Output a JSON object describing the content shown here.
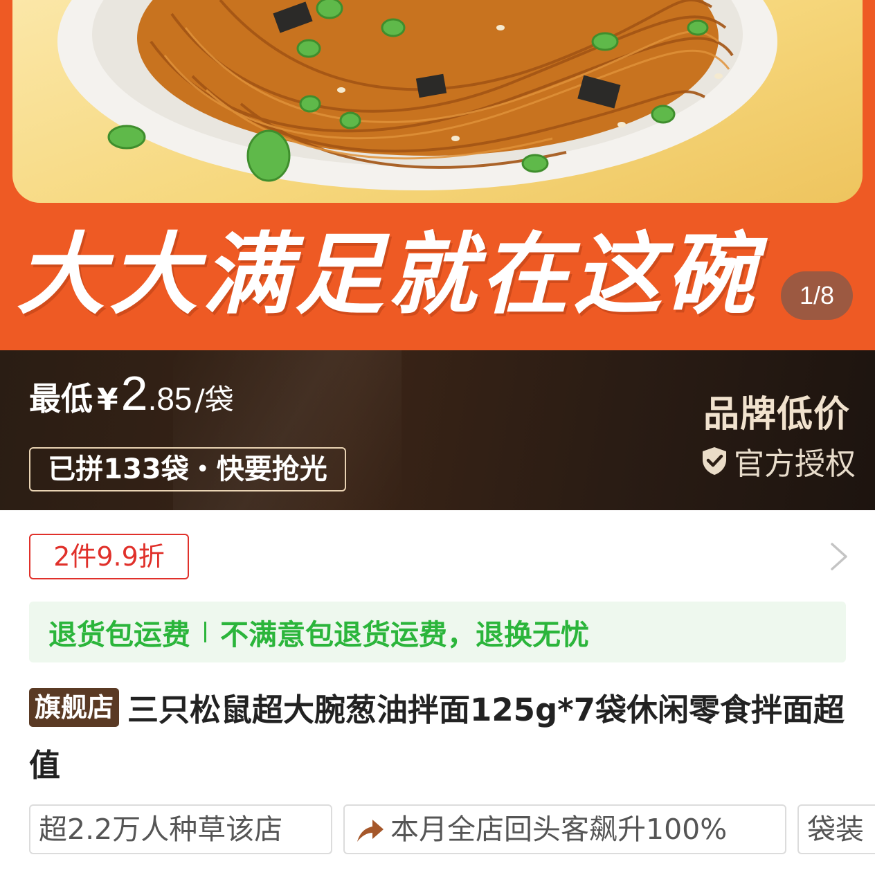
{
  "hero": {
    "slogan": "大大满足就在这碗",
    "page_counter": "1/8"
  },
  "price": {
    "prefix": "最低",
    "currency": "¥",
    "integer": "2",
    "decimal": ".85",
    "unit": "/袋",
    "sold_text": "已拼133袋・快要抢光"
  },
  "brand": {
    "low_price_label": "品牌低价",
    "auth_label": "官方授权",
    "auth_icon": "shield-check-icon"
  },
  "coupon": {
    "label": "2件9.9折"
  },
  "service": {
    "left": "退货包运费",
    "right": "不满意包退货运费，退换无忧",
    "color": "#2bb53b"
  },
  "product": {
    "store_tag": "旗舰店",
    "title": "三只松鼠超大腕葱油拌面125g*7袋休闲零食拌面超值"
  },
  "tags": [
    "超2.2万人种草该店",
    "本月全店回头客飙升100%",
    "袋装"
  ],
  "colors": {
    "hero_bg": "#ee5a24",
    "coupon_red": "#e0302a",
    "banner_dark": "#2a1d14",
    "store_tag_bg": "#5a3a24"
  }
}
